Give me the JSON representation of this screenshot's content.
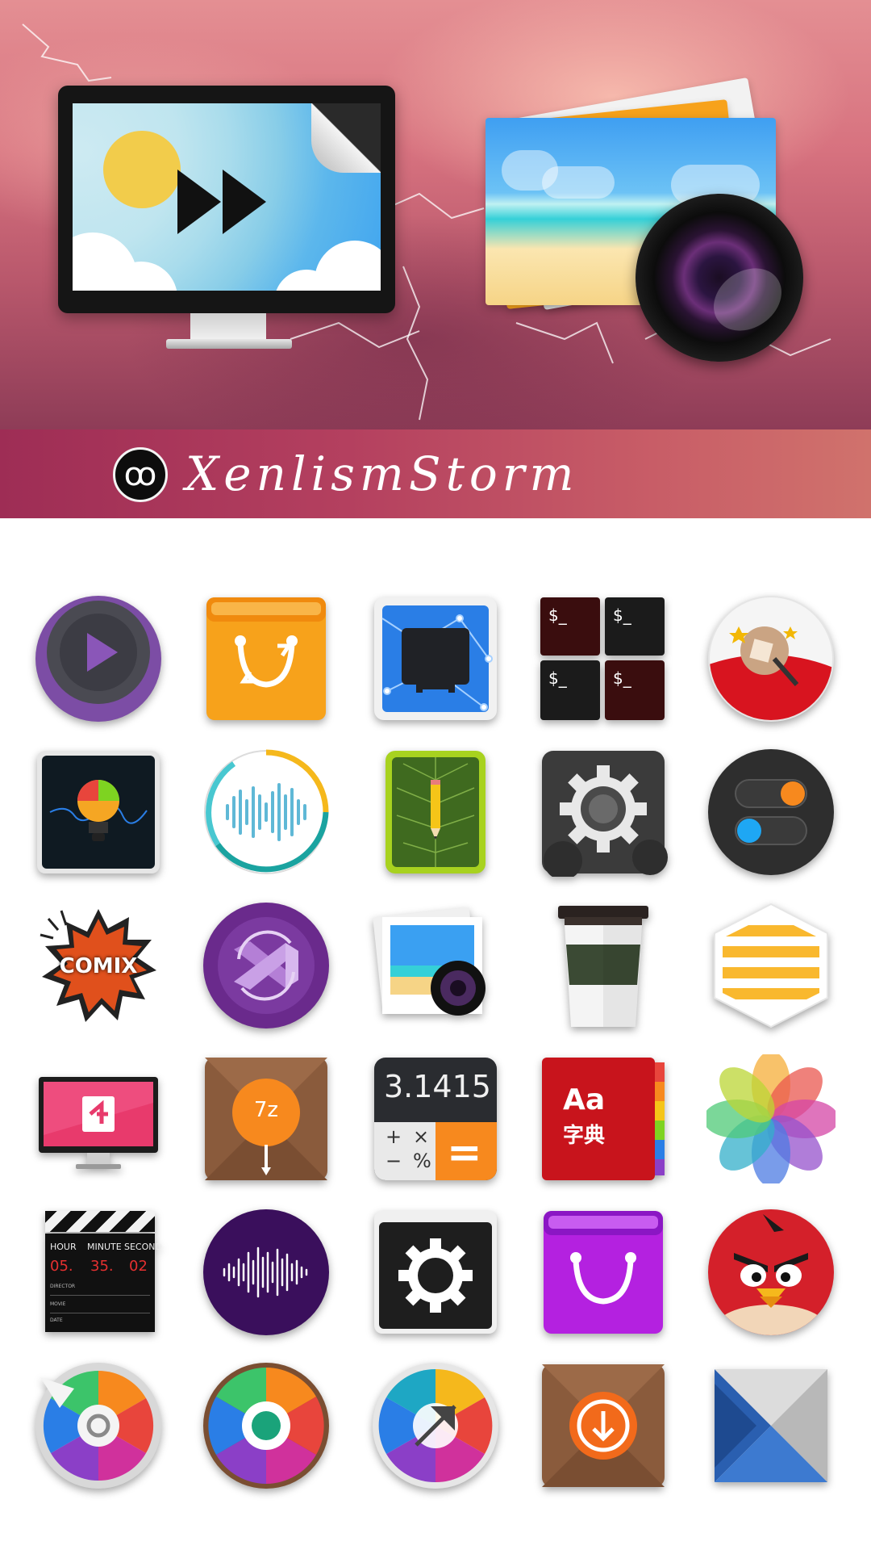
{
  "brand": {
    "name": "XenlismStorm",
    "logo_glyph": "ꝏ"
  },
  "hero": {
    "left_icon": "video-player-monitor-icon",
    "right_icon": "photos-camera-icon"
  },
  "colors": {
    "banner_start": "#9e2d55",
    "banner_end": "#d0726c",
    "sky_top": "#e48f93",
    "sky_bottom": "#8e3c57"
  },
  "terminal": {
    "prompt": "$_"
  },
  "comix": {
    "label": "COMIX"
  },
  "archiver": {
    "label": "7z"
  },
  "calculator": {
    "display": "3.1415",
    "ops": [
      "+",
      "×",
      "−",
      "%",
      "="
    ]
  },
  "dictionary": {
    "latin": "Aa",
    "cjk": "字典"
  },
  "clapper": {
    "labels": [
      "HOUR",
      "MINUTE",
      "SECOND"
    ],
    "values": [
      "05.",
      "35.",
      "02"
    ],
    "rows": [
      "DIRECTOR",
      "MOVIE",
      "DATE"
    ]
  }
}
